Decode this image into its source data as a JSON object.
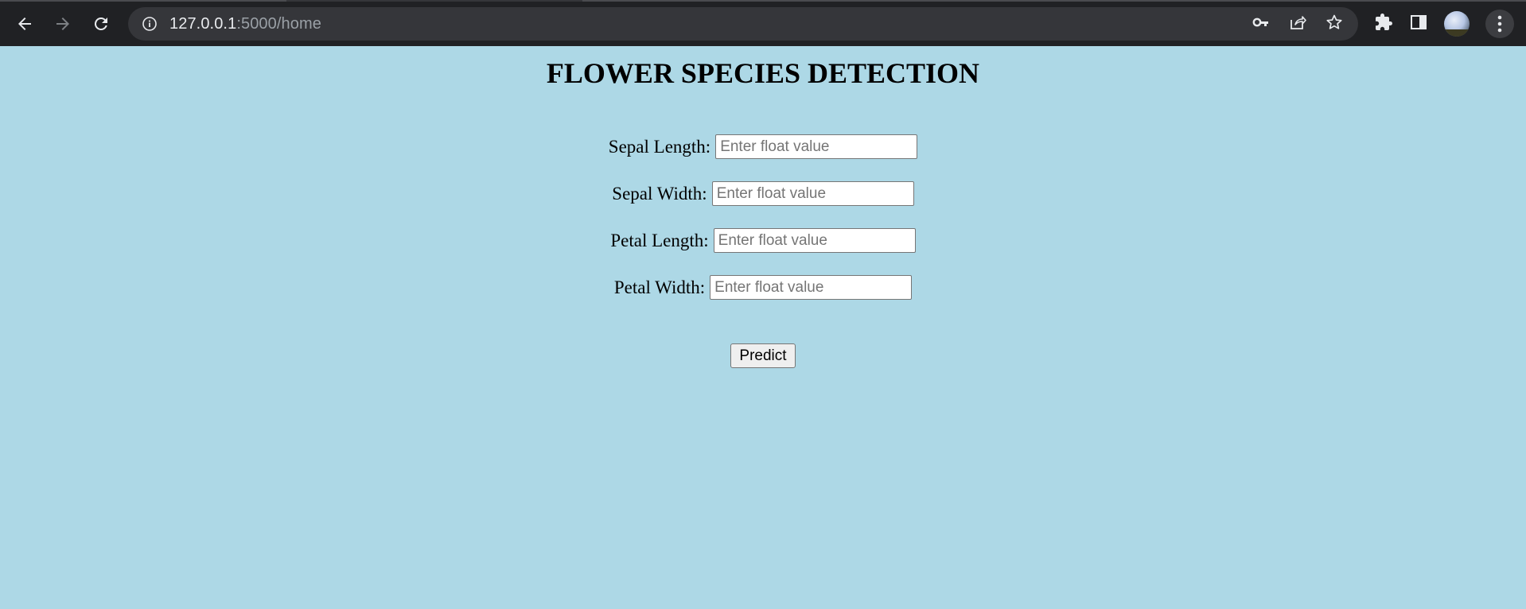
{
  "browser": {
    "url_host": "127.0.0.1",
    "url_path": ":5000/home",
    "icons": {
      "back": "back-arrow-icon",
      "forward": "forward-arrow-icon",
      "reload": "reload-icon",
      "site_info": "info-icon",
      "password": "key-icon",
      "share": "share-icon",
      "bookmark": "star-icon",
      "extensions": "puzzle-icon",
      "side_panel": "side-panel-icon",
      "profile": "avatar",
      "menu": "kebab-menu-icon"
    }
  },
  "page": {
    "title": "FLOWER SPECIES DETECTION",
    "background_color": "#add8e6",
    "fields": [
      {
        "label": "Sepal Length:",
        "placeholder": "Enter float value",
        "value": ""
      },
      {
        "label": "Sepal Width:",
        "placeholder": "Enter float value",
        "value": ""
      },
      {
        "label": "Petal Length:",
        "placeholder": "Enter float value",
        "value": ""
      },
      {
        "label": "Petal Width:",
        "placeholder": "Enter float value",
        "value": ""
      }
    ],
    "submit_label": "Predict"
  }
}
